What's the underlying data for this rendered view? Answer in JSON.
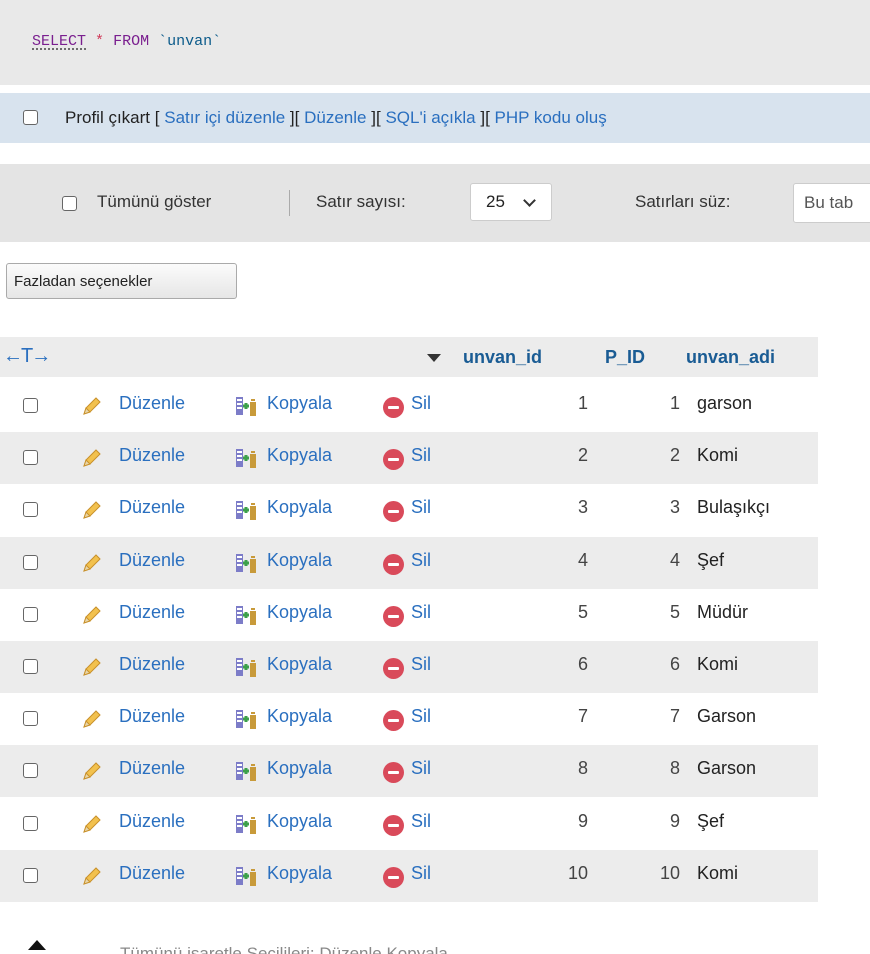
{
  "sql": {
    "select": "SELECT",
    "star": "*",
    "from": "FROM",
    "table": "`unvan`"
  },
  "profil": {
    "label": "Profil çıkart",
    "open": "[",
    "close": "]",
    "links": [
      "Satır içi düzenle",
      "Düzenle",
      "SQL'i açıkla",
      "PHP kodu oluş"
    ]
  },
  "nav": {
    "show_all_label": "Tümünü göster",
    "row_count_label": "Satır sayısı:",
    "row_count_value": "25",
    "filter_label": "Satırları süz:",
    "filter_placeholder": "Bu tab"
  },
  "more_options_button": "Fazladan seçenekler",
  "table": {
    "arrows": "←T→",
    "columns": [
      "unvan_id",
      "P_ID",
      "unvan_adi"
    ],
    "actions": {
      "edit": "Düzenle",
      "copy": "Kopyala",
      "delete": "Sil"
    },
    "rows": [
      {
        "unvan_id": "1",
        "p_id": "1",
        "unvan_adi": "garson"
      },
      {
        "unvan_id": "2",
        "p_id": "2",
        "unvan_adi": "Komi"
      },
      {
        "unvan_id": "3",
        "p_id": "3",
        "unvan_adi": "Bulaşıkçı"
      },
      {
        "unvan_id": "4",
        "p_id": "4",
        "unvan_adi": "Şef"
      },
      {
        "unvan_id": "5",
        "p_id": "5",
        "unvan_adi": "Müdür"
      },
      {
        "unvan_id": "6",
        "p_id": "6",
        "unvan_adi": "Komi"
      },
      {
        "unvan_id": "7",
        "p_id": "7",
        "unvan_adi": "Garson"
      },
      {
        "unvan_id": "8",
        "p_id": "8",
        "unvan_adi": "Garson"
      },
      {
        "unvan_id": "9",
        "p_id": "9",
        "unvan_adi": "Şef"
      },
      {
        "unvan_id": "10",
        "p_id": "10",
        "unvan_adi": "Komi"
      }
    ]
  },
  "bottom": {
    "text": "Tümünü işaretle    Seçilileri:    Düzenle    Kopyala"
  },
  "colors": {
    "link": "#2a6fbf",
    "header_text": "#1a5c94",
    "delete_icon": "#d94a5a",
    "profil_bar": "#d8e3ee"
  }
}
